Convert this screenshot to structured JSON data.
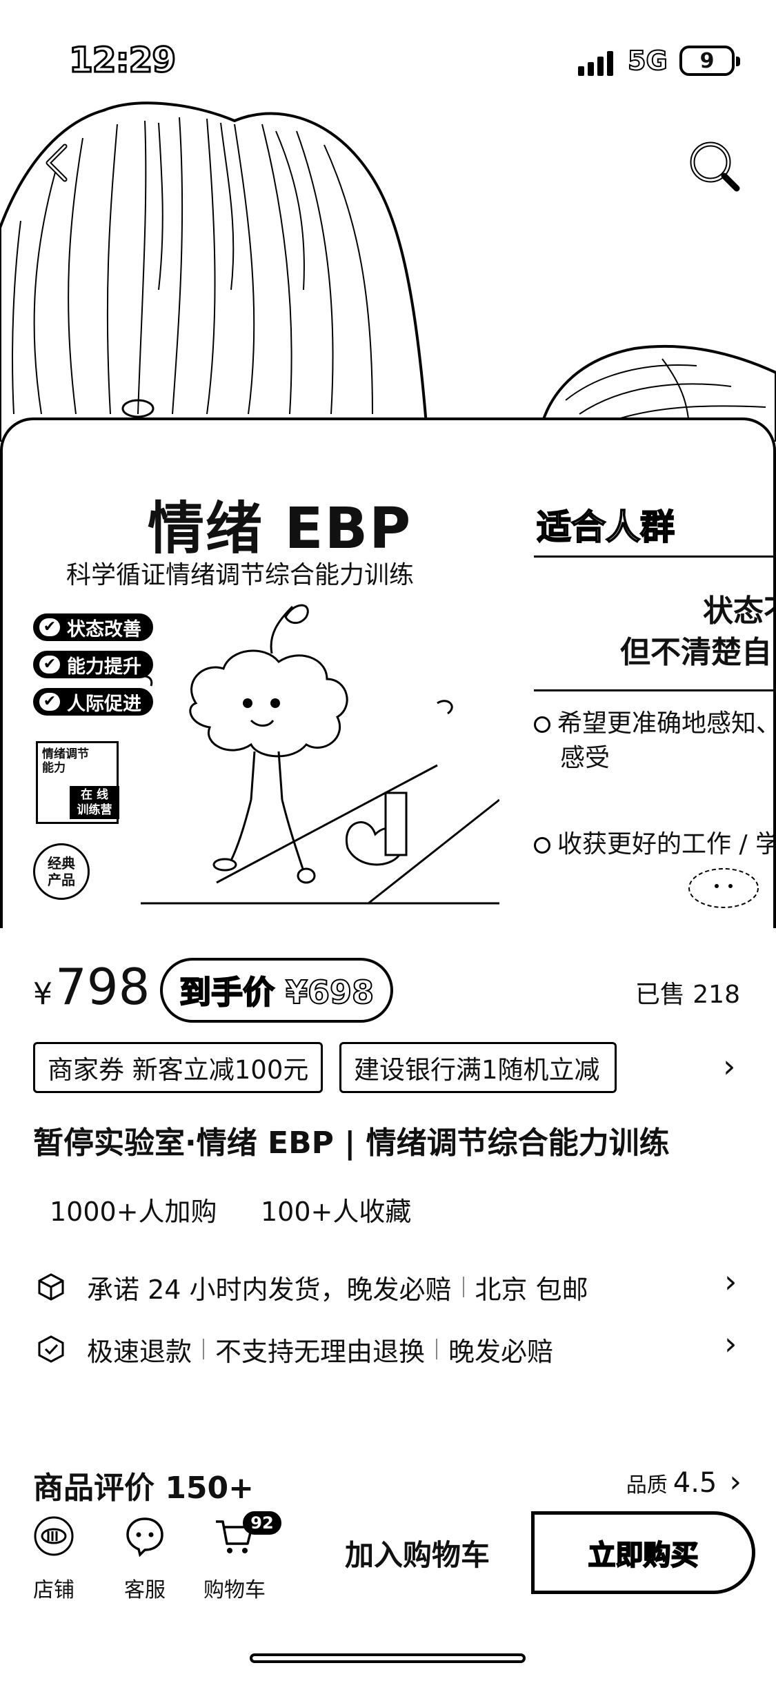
{
  "status_bar": {
    "time": "12:29",
    "network": "5G",
    "battery": "9"
  },
  "product_card": {
    "title": "情绪 EBP",
    "subtitle": "科学循证情绪调节综合能力训练",
    "badges": [
      "状态改善",
      "能力提升",
      "人际促进"
    ],
    "book_label": "情绪调节\n能力",
    "book_tag": "在 线\n训练营",
    "classic_label": "经典\n产品",
    "fit_title": "适合人群",
    "fit_line1": "状态不",
    "fit_line2": "但不清楚自",
    "fit_items": [
      "希望更准确地感知、",
      "感受",
      "收获更好的工作 / 学"
    ]
  },
  "price": {
    "currency": "¥",
    "amount": "798",
    "final_label": "到手价 ¥698",
    "sold": "已售 218"
  },
  "coupons": [
    "商家券 新客立减100元",
    "建设银行满1随机立减"
  ],
  "product_name": "暂停实验室·情绪 EBP | 情绪调节综合能力训练",
  "stats": {
    "add_cart": "1000+人加购",
    "favorites": "100+人收藏"
  },
  "services": {
    "shipping": [
      "承诺 24 小时内发货，晚发必赔",
      "北京 包邮"
    ],
    "refund": [
      "极速退款",
      "不支持无理由退换",
      "晚发必赔"
    ]
  },
  "reviews": {
    "title": "商品评价 150+",
    "quality_label": "品质",
    "quality_score": "4.5"
  },
  "bottom_bar": {
    "store": "店铺",
    "service": "客服",
    "cart": "购物车",
    "cart_count": "92",
    "add_to_cart": "加入购物车",
    "buy_now": "立即购买"
  },
  "icons": {
    "back": "back-icon",
    "search": "search-icon",
    "chevron": "chevron-right-icon",
    "shipping": "box-icon",
    "refund": "shield-check-icon",
    "store": "store-icon",
    "service": "chat-icon",
    "cart": "cart-icon"
  }
}
